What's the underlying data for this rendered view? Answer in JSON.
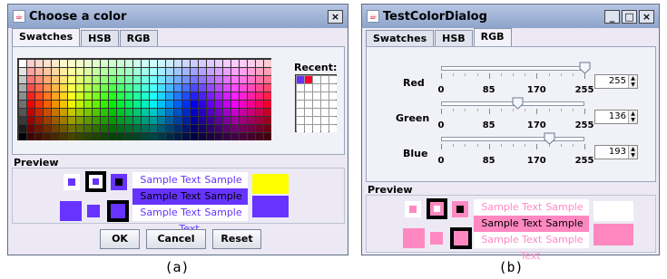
{
  "window_a": {
    "title": "Choose a color",
    "close_label": "×",
    "tabs": [
      {
        "label": "Swatches",
        "selected": true
      },
      {
        "label": "HSB",
        "selected": false
      },
      {
        "label": "RGB",
        "selected": false
      }
    ],
    "recent_label": "Recent:",
    "recent_colors": [
      "#6633ff",
      "#ff0033"
    ],
    "preview_label": "Preview",
    "selected_color": "#6633ff",
    "sample_text": "Sample Text",
    "foreground_preview": "#ffff00",
    "buttons": {
      "ok": "OK",
      "cancel": "Cancel",
      "reset": "Reset"
    }
  },
  "window_b": {
    "title": "TestColorDialog",
    "controls": {
      "minimize": "_",
      "maximize": "□",
      "close": "×"
    },
    "tabs": [
      {
        "label": "Swatches",
        "selected": false
      },
      {
        "label": "HSB",
        "selected": false
      },
      {
        "label": "RGB",
        "selected": true
      }
    ],
    "channels": [
      {
        "label": "Red",
        "value": "255",
        "fraction": 1.0
      },
      {
        "label": "Green",
        "value": "136",
        "fraction": 0.533
      },
      {
        "label": "Blue",
        "value": "193",
        "fraction": 0.757
      }
    ],
    "tick_labels": [
      "0",
      "85",
      "170",
      "255"
    ],
    "preview_label": "Preview",
    "selected_color": "#ff88c1",
    "sample_text": "Sample Text"
  },
  "captions": {
    "a": "(a)",
    "b": "(b)"
  }
}
